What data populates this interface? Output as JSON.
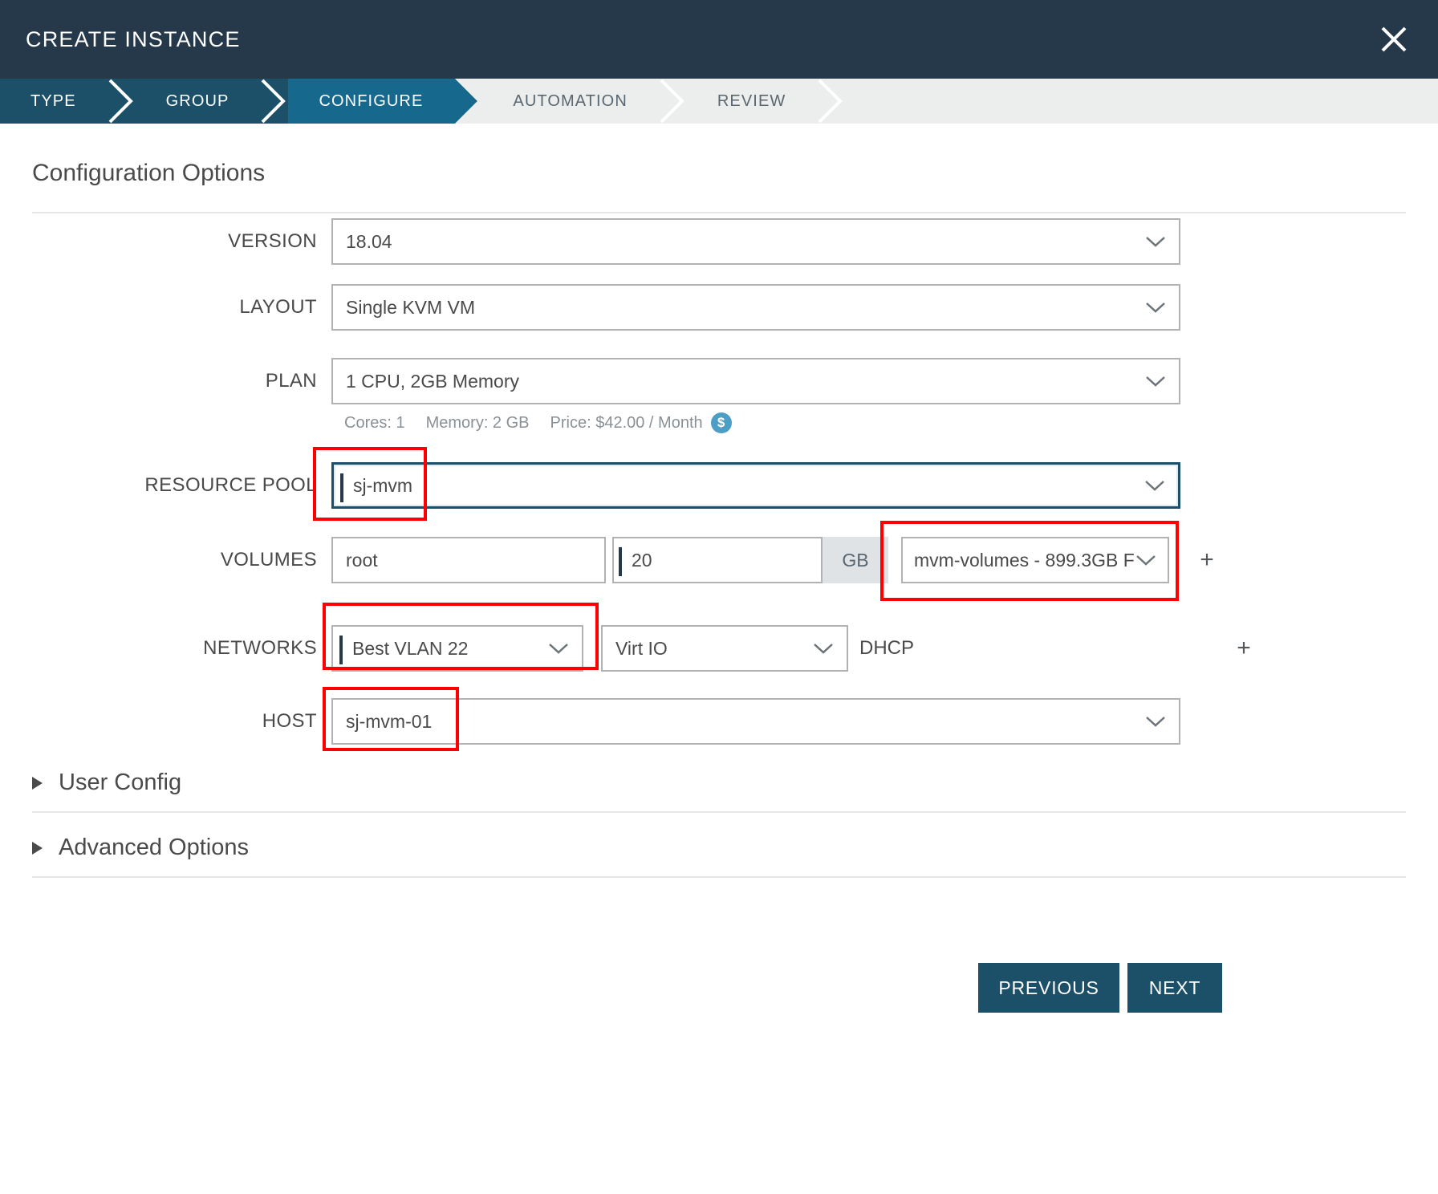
{
  "window": {
    "title": "CREATE INSTANCE",
    "close_icon": "close-icon"
  },
  "steps": [
    {
      "label": "TYPE",
      "state": "done"
    },
    {
      "label": "GROUP",
      "state": "done"
    },
    {
      "label": "CONFIGURE",
      "state": "active"
    },
    {
      "label": "AUTOMATION",
      "state": "todo"
    },
    {
      "label": "REVIEW",
      "state": "todo"
    }
  ],
  "main": {
    "section_title": "Configuration Options",
    "fields": {
      "version": {
        "label": "VERSION",
        "value": "18.04"
      },
      "layout": {
        "label": "LAYOUT",
        "value": "Single KVM VM"
      },
      "plan": {
        "label": "PLAN",
        "value": "1 CPU, 2GB Memory"
      },
      "plan_info": {
        "cores": "Cores: 1",
        "memory": "Memory: 2 GB",
        "price": "Price: $42.00 / Month",
        "price_badge": "$"
      },
      "resource_pool": {
        "label": "RESOURCE POOL",
        "value": "sj-mvm"
      },
      "volumes": {
        "label": "VOLUMES",
        "name": "root",
        "size": "20",
        "unit": "GB",
        "datastore": "mvm-volumes - 899.3GB F",
        "add": "+"
      },
      "networks": {
        "label": "NETWORKS",
        "network": "Best VLAN 22",
        "nic_type": "Virt IO",
        "ip_mode": "DHCP",
        "add": "+"
      },
      "host": {
        "label": "HOST",
        "value": "sj-mvm-01"
      }
    },
    "expandos": [
      {
        "label": "User Config"
      },
      {
        "label": "Advanced Options"
      }
    ]
  },
  "footer": {
    "previous": "PREVIOUS",
    "next": "NEXT"
  },
  "colors": {
    "titlebar": "#26394a",
    "step_done": "#1b5068",
    "step_active": "#17688d",
    "step_todo_bg": "#eceded",
    "accent": "#1b5068",
    "highlight": "#ff0000",
    "price_badge": "#4c9ec4"
  }
}
